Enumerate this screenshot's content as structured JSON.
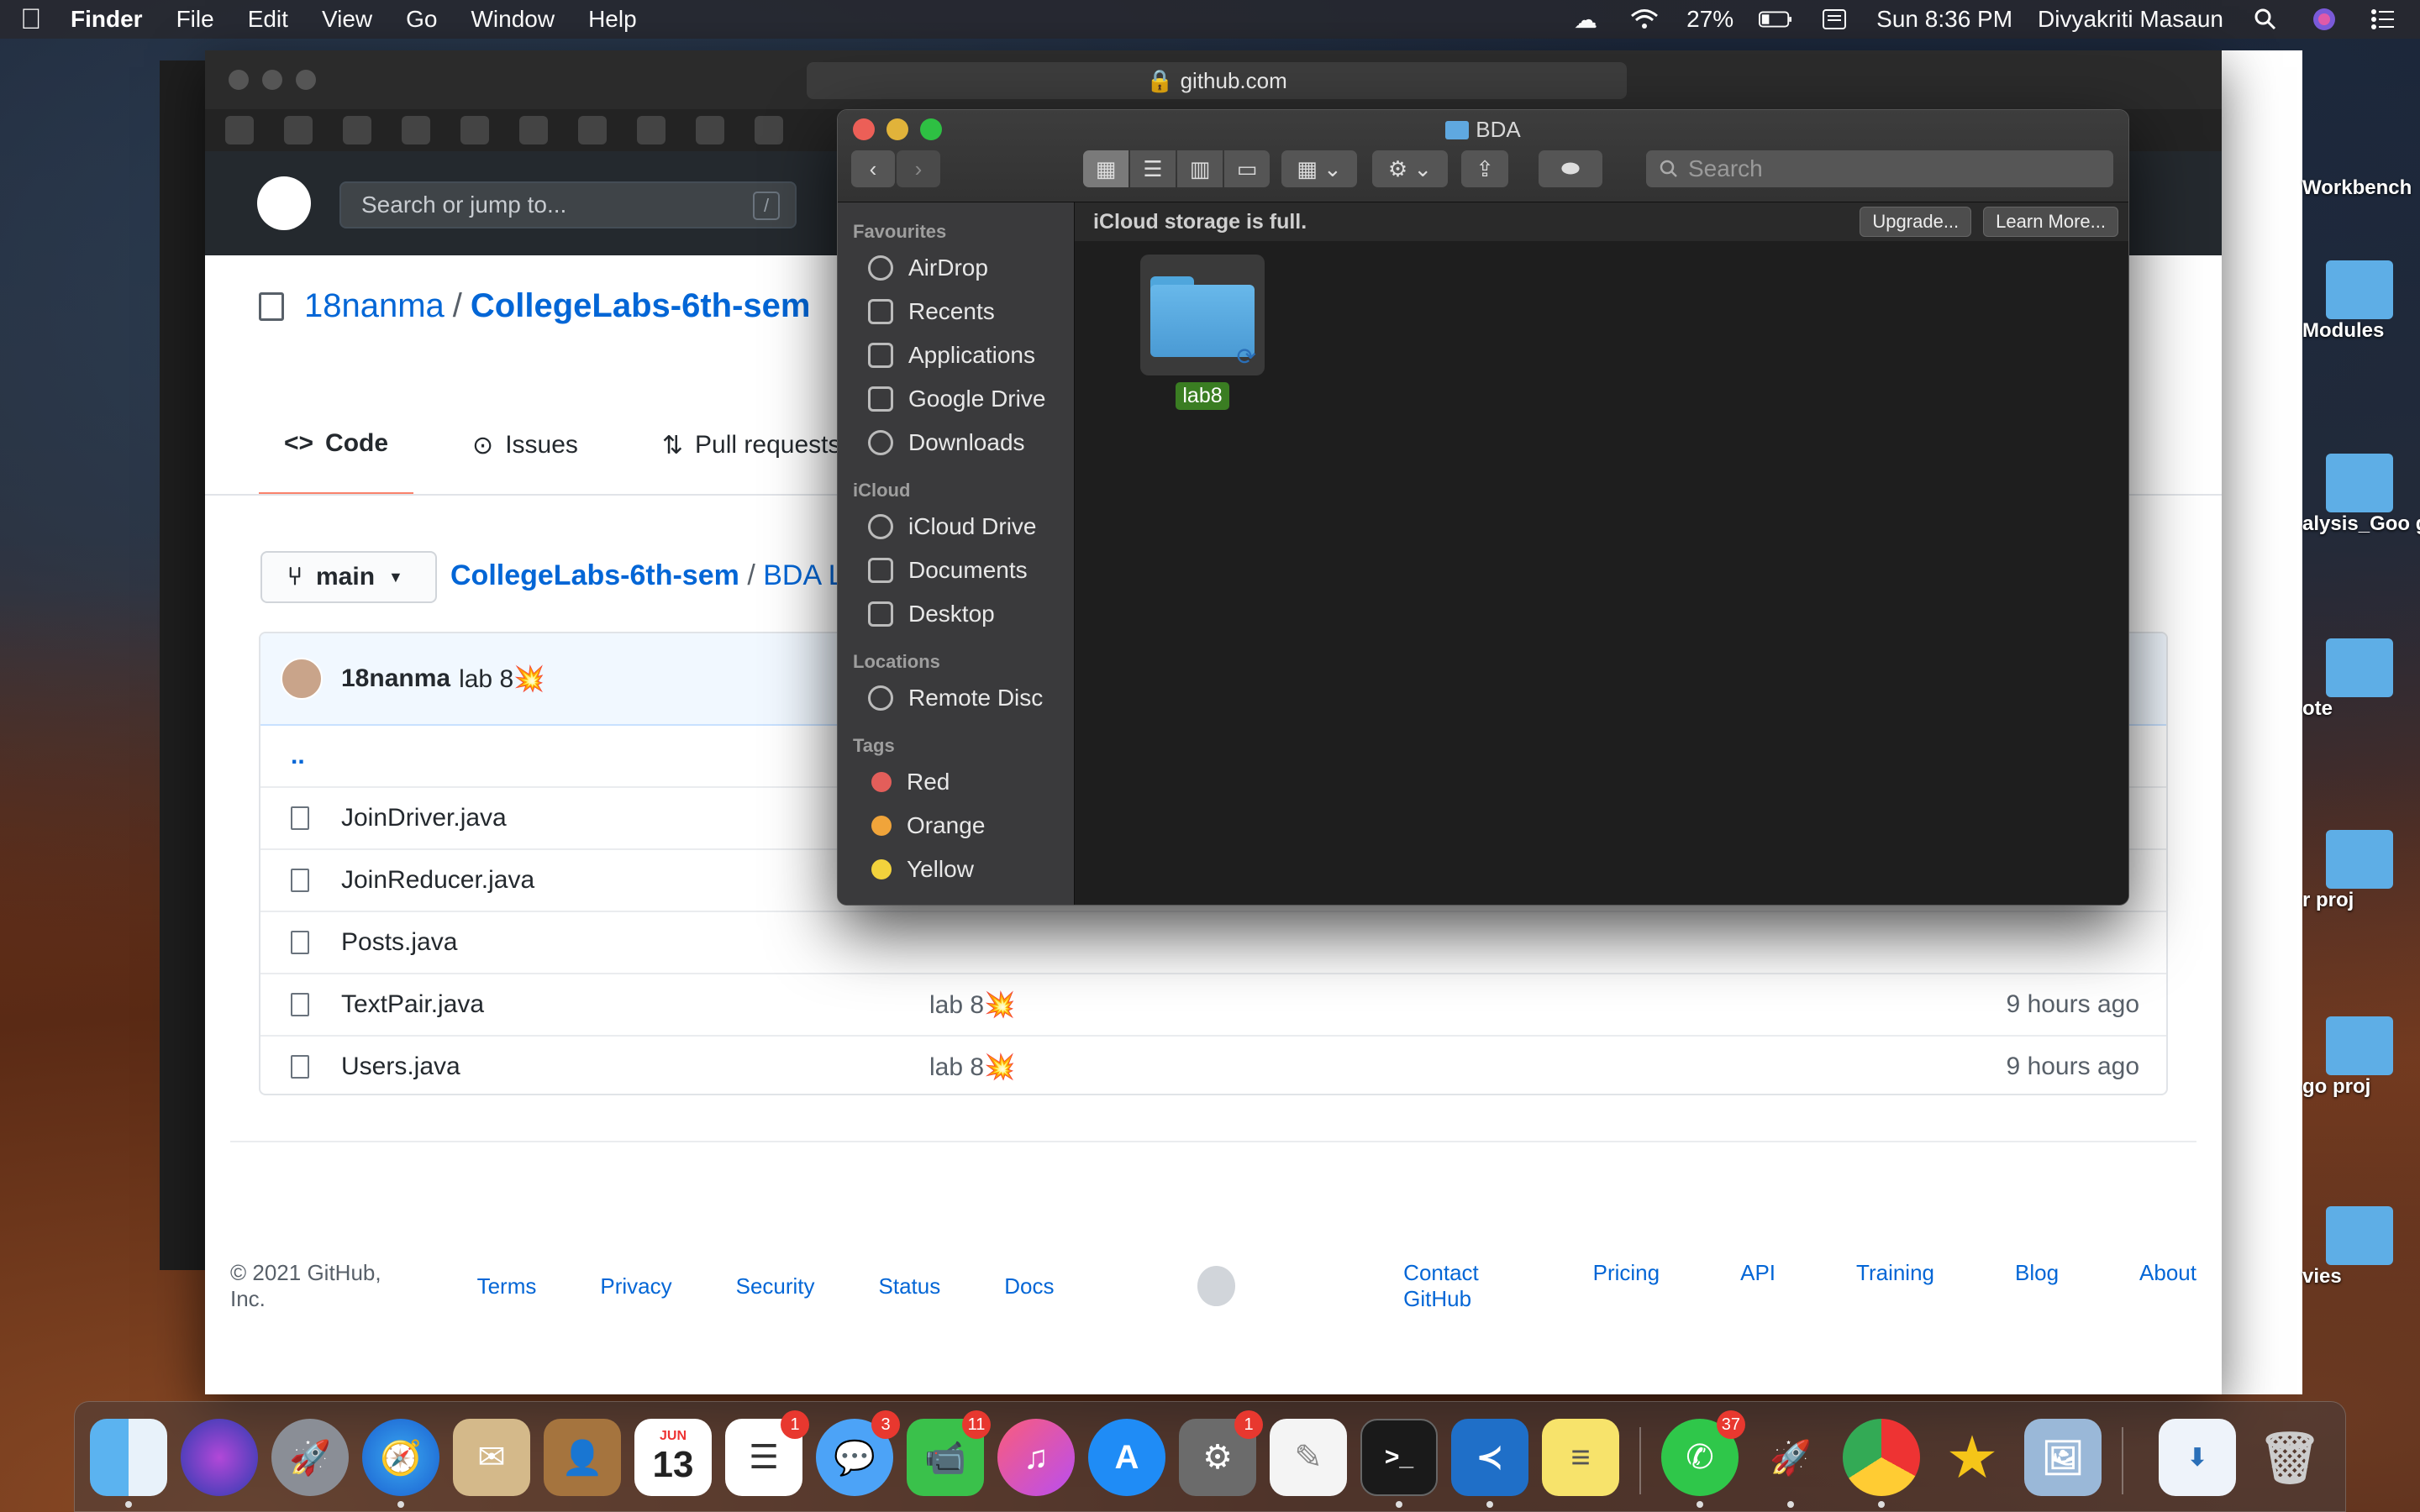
{
  "menubar": {
    "app_name": "Finder",
    "menus": [
      "File",
      "Edit",
      "View",
      "Go",
      "Window",
      "Help"
    ],
    "battery": "27%",
    "clock": "Sun 8:36 PM",
    "user": "Divyakriti Masaun"
  },
  "browser": {
    "url": "github.com",
    "search_placeholder": "Search or jump to...",
    "search_shortcut": "/",
    "repo_owner": "18nanma",
    "repo_sep": "/",
    "repo_name": "CollegeLabs-6th-sem",
    "tabs": {
      "code": "Code",
      "issues": "Issues",
      "pulls": "Pull requests"
    },
    "branch": "main",
    "breadcrumb_repo": "CollegeLabs-6th-sem",
    "breadcrumb_sep": "/",
    "breadcrumb_folder": "BDA La",
    "commit_user": "18nanma",
    "commit_msg": "lab 8💥",
    "parent_dir": "..",
    "files": [
      {
        "name": "JoinDriver.java",
        "msg": "",
        "age": ""
      },
      {
        "name": "JoinReducer.java",
        "msg": "",
        "age": ""
      },
      {
        "name": "Posts.java",
        "msg": "",
        "age": ""
      },
      {
        "name": "TextPair.java",
        "msg": "lab 8💥",
        "age": "9 hours ago"
      },
      {
        "name": "Users.java",
        "msg": "lab 8💥",
        "age": "9 hours ago"
      }
    ],
    "footer": {
      "copyright": "© 2021 GitHub, Inc.",
      "left_links": [
        "Terms",
        "Privacy",
        "Security",
        "Status",
        "Docs"
      ],
      "right_links": [
        "Contact GitHub",
        "Pricing",
        "API",
        "Training",
        "Blog",
        "About"
      ]
    }
  },
  "finder": {
    "title": "BDA",
    "search_placeholder": "Search",
    "icloud_notice": "iCloud storage is full.",
    "upgrade_label": "Upgrade...",
    "learn_more_label": "Learn More...",
    "sections": {
      "favourites": "Favourites",
      "icloud": "iCloud",
      "locations": "Locations",
      "tags": "Tags"
    },
    "favourites": [
      "AirDrop",
      "Recents",
      "Applications",
      "Google Drive",
      "Downloads"
    ],
    "icloud_items": [
      "iCloud Drive",
      "Documents",
      "Desktop"
    ],
    "locations": [
      "Remote Disc"
    ],
    "tags": [
      {
        "label": "Red",
        "color": "#e35e5a"
      },
      {
        "label": "Orange",
        "color": "#f0a43a"
      },
      {
        "label": "Yellow",
        "color": "#f2d23c"
      }
    ],
    "folder_name": "lab8"
  },
  "desktop_labels": [
    "Workbench",
    "Modules",
    "alysis_Goo gle",
    "ote",
    "r proj",
    "go proj",
    "vies"
  ],
  "dock": {
    "calendar_month": "JUN",
    "calendar_day": "13",
    "badges": {
      "reminders": "1",
      "messages": "3",
      "facetime": "11",
      "prefs": "1",
      "whatsapp": "37"
    }
  }
}
